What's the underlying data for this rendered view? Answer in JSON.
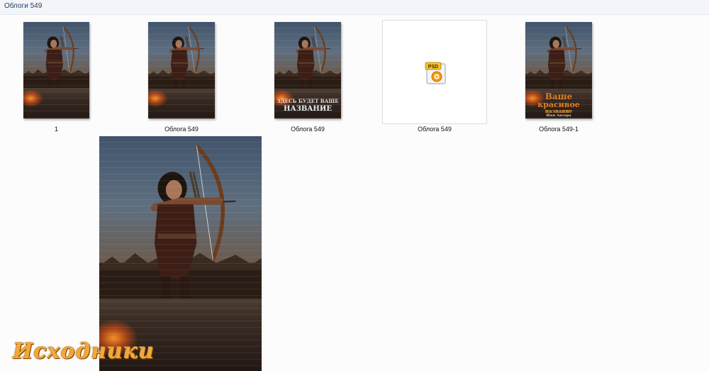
{
  "window": {
    "title": "Облоги 549"
  },
  "files": [
    {
      "name": "1"
    },
    {
      "name": "Облога  549"
    },
    {
      "name": "Облога 549",
      "cover_lines": [
        "ЗДЕСЬ БУДЕТ ВАШЕ",
        "НАЗВАНИЕ"
      ]
    },
    {
      "name": "Облога 549",
      "file_type": "PSD",
      "icon": "photoshop-psd-icon"
    },
    {
      "name": "Облога 549-1",
      "cover_lines": [
        "Ваше",
        "красивое",
        "название",
        "Имя Автора"
      ]
    }
  ],
  "preview": {
    "name": "Облога 549 large preview"
  },
  "watermark": {
    "text": "Исходники"
  },
  "colors": {
    "topbar": "#f3f5f8",
    "title_text": "#1e3a5f",
    "watermark": "#f0a93a",
    "psd_orange": "#f39c12"
  }
}
